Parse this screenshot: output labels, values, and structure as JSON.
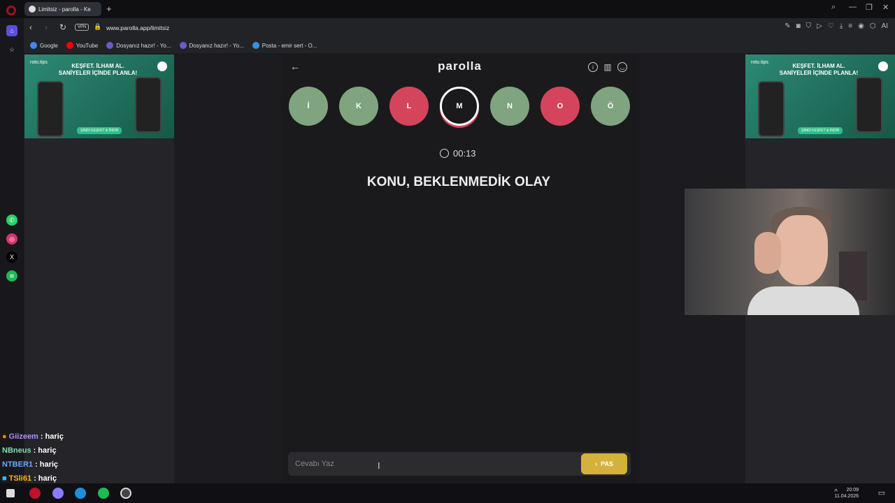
{
  "browser": {
    "tab_title": "Limitsiz - parolla - Ke",
    "url": "www.parolla.app/limitsiz",
    "vpn_label": "VPN",
    "ai_label": "AI"
  },
  "bookmarks": [
    {
      "label": "Google"
    },
    {
      "label": "YouTube"
    },
    {
      "label": "Dosyanız hazır! - Yo..."
    },
    {
      "label": "Dosyanız hazır! - Yo..."
    },
    {
      "label": "Posta - emir sert - O..."
    }
  ],
  "ads": {
    "brand": "roto.tips",
    "headline_1": "KEŞFET. İLHAM AL.",
    "headline_2": "SANİYELER İÇİNDE PLANLA!",
    "cta": "ŞİMDİ KEŞFET & İNDİR"
  },
  "game": {
    "logo": "parolla",
    "letters": [
      {
        "letter": "İ",
        "state": "correct",
        "color": "#7fa47f"
      },
      {
        "letter": "K",
        "state": "correct",
        "color": "#7fa47f"
      },
      {
        "letter": "L",
        "state": "wrong",
        "color": "#d4455c"
      },
      {
        "letter": "M",
        "state": "current",
        "color": "#1a1a1d"
      },
      {
        "letter": "N",
        "state": "correct",
        "color": "#7fa47f"
      },
      {
        "letter": "O",
        "state": "wrong",
        "color": "#d4455c"
      },
      {
        "letter": "Ö",
        "state": "correct",
        "color": "#7fa47f"
      }
    ],
    "timer": "00:13",
    "topic": "KONU, BEKLENMEDİK OLAY",
    "answer_placeholder": "Cevabı Yaz",
    "pass_label": "PAS",
    "pass_color": "#d4b13a"
  },
  "chat": [
    {
      "user": "Giizeem",
      "msg": ": hariç",
      "color": "#b48cff"
    },
    {
      "user": "NBneus",
      "msg": ": hariç",
      "color": "#7ddfae"
    },
    {
      "user": "NTBER1",
      "msg": ": hariç",
      "color": "#6aa6ff"
    },
    {
      "user": "TSli61",
      "msg": ": hariç",
      "color": "#ffb020"
    }
  ],
  "taskbar": {
    "time": "20:09",
    "date": "11.04.2026"
  }
}
